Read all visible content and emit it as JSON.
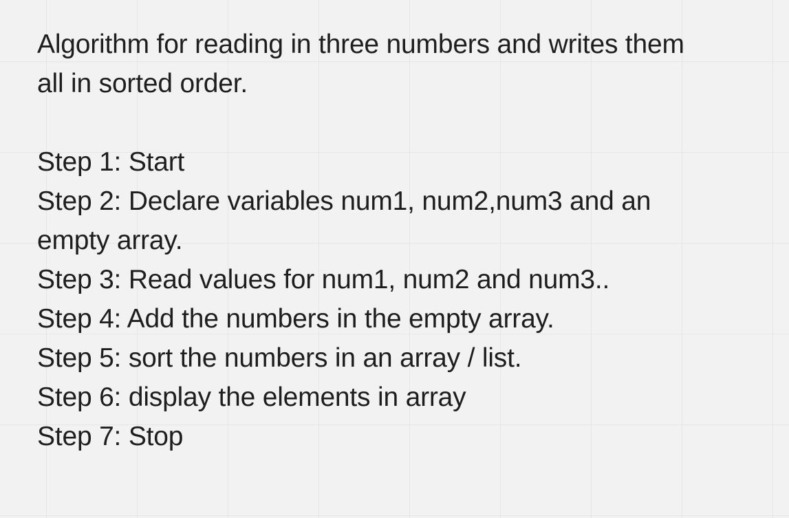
{
  "note": {
    "title": "Algorithm for reading in three numbers and writes them all in sorted order.",
    "steps": [
      "Step 1: Start",
      "Step 2: Declare variables num1, num2,num3 and an empty array.",
      "Step 3: Read values for num1, num2 and num3..",
      "Step 4: Add the numbers in the empty array.",
      "Step 5: sort the numbers in an array / list.",
      "Step 6: display the elements in array",
      "Step 7: Stop"
    ]
  }
}
